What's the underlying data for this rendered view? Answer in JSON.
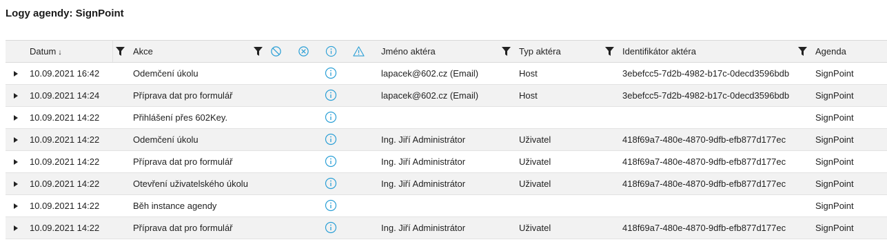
{
  "page": {
    "title": "Logy agendy: SignPoint"
  },
  "columns": {
    "datum": "Datum",
    "sort_indicator": "↓",
    "akce": "Akce",
    "jmeno": "Jméno aktéra",
    "typ": "Typ aktéra",
    "identifikator": "Identifikátor aktéra",
    "agenda": "Agenda"
  },
  "header_icons": [
    "filter-icon",
    "ban-icon",
    "cancel-circle-icon",
    "info-icon",
    "warning-icon"
  ],
  "colors": {
    "accent": "#2a9fd6",
    "row_alt": "#f2f2f2",
    "header_bg": "#f2f2f2"
  },
  "rows": [
    {
      "datum": "10.09.2021 16:42",
      "akce": "Odemčení úkolu",
      "jmeno": "lapacek@602.cz (Email)",
      "typ": "Host",
      "identifikator": "3ebefcc5-7d2b-4982-b17c-0decd3596bdb",
      "agenda": "SignPoint"
    },
    {
      "datum": "10.09.2021 14:24",
      "akce": "Příprava dat pro formulář",
      "jmeno": "lapacek@602.cz (Email)",
      "typ": "Host",
      "identifikator": "3ebefcc5-7d2b-4982-b17c-0decd3596bdb",
      "agenda": "SignPoint"
    },
    {
      "datum": "10.09.2021 14:22",
      "akce": "Přihlášení přes 602Key.",
      "jmeno": "",
      "typ": "",
      "identifikator": "",
      "agenda": "SignPoint"
    },
    {
      "datum": "10.09.2021 14:22",
      "akce": "Odemčení úkolu",
      "jmeno": "Ing. Jiří Administrátor",
      "typ": "Uživatel",
      "identifikator": "418f69a7-480e-4870-9dfb-efb877d177ec",
      "agenda": "SignPoint"
    },
    {
      "datum": "10.09.2021 14:22",
      "akce": "Příprava dat pro formulář",
      "jmeno": "Ing. Jiří Administrátor",
      "typ": "Uživatel",
      "identifikator": "418f69a7-480e-4870-9dfb-efb877d177ec",
      "agenda": "SignPoint"
    },
    {
      "datum": "10.09.2021 14:22",
      "akce": "Otevření uživatelského úkolu",
      "jmeno": "Ing. Jiří Administrátor",
      "typ": "Uživatel",
      "identifikator": "418f69a7-480e-4870-9dfb-efb877d177ec",
      "agenda": "SignPoint"
    },
    {
      "datum": "10.09.2021 14:22",
      "akce": "Běh instance agendy",
      "jmeno": "",
      "typ": "",
      "identifikator": "",
      "agenda": "SignPoint"
    },
    {
      "datum": "10.09.2021 14:22",
      "akce": "Příprava dat pro formulář",
      "jmeno": "Ing. Jiří Administrátor",
      "typ": "Uživatel",
      "identifikator": "418f69a7-480e-4870-9dfb-efb877d177ec",
      "agenda": "SignPoint"
    }
  ]
}
